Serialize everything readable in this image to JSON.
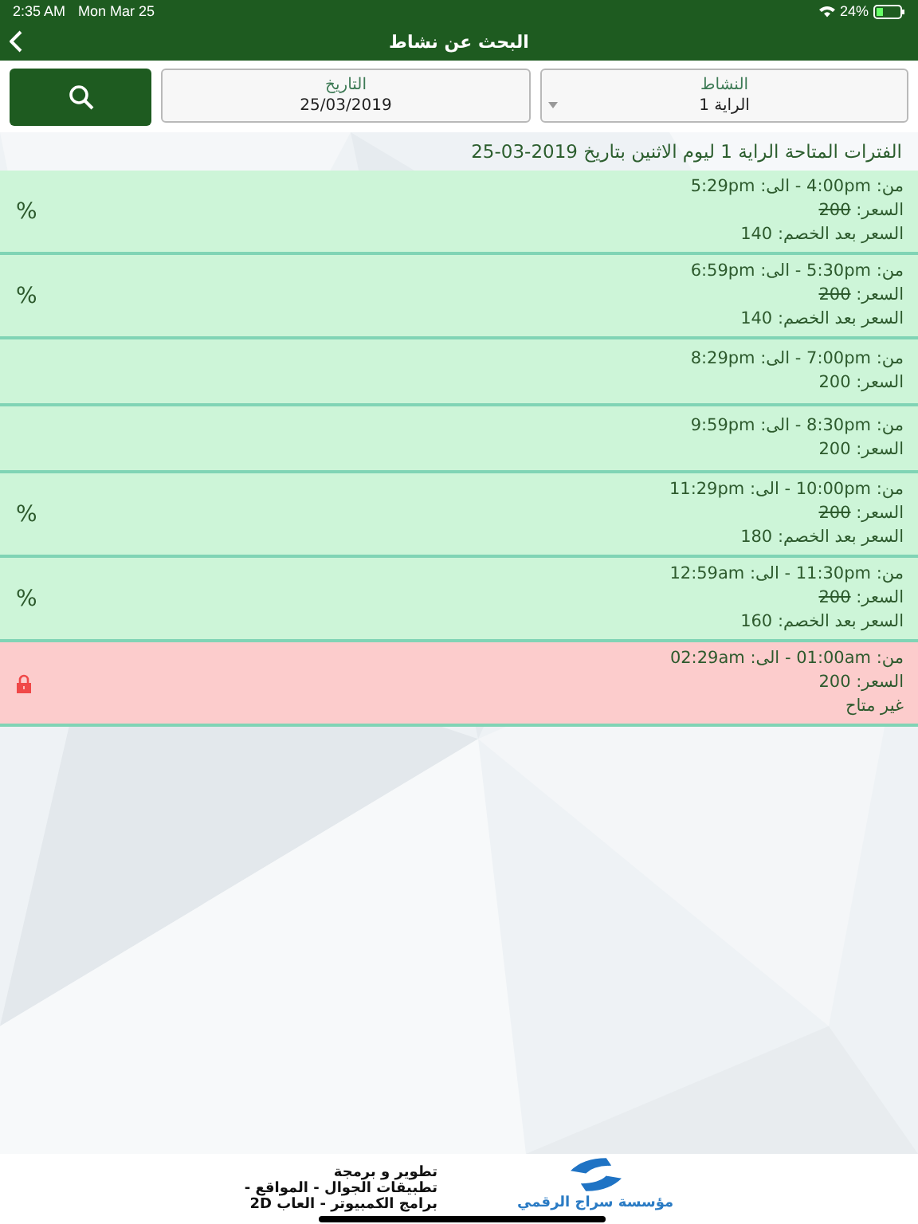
{
  "status_bar": {
    "time": "2:35 AM",
    "date": "Mon Mar 25",
    "battery": "24%"
  },
  "nav": {
    "title": "البحث عن نشاط"
  },
  "search": {
    "activity": {
      "label": "النشاط",
      "value": "الراية 1"
    },
    "date": {
      "label": "التاريخ",
      "value": "25/03/2019"
    }
  },
  "heading": "الفترات المتاحة الراية 1 ليوم الاثنين بتاريخ 2019-03-25",
  "slots": [
    {
      "kind": "discount",
      "time": "من: 4:00pm  -  الى: 5:29pm",
      "price_label": "السعر:",
      "price": "200",
      "price_struck": true,
      "note": "السعر بعد الخصم: 140",
      "badge": "%"
    },
    {
      "kind": "discount",
      "time": "من: 5:30pm  -  الى: 6:59pm",
      "price_label": "السعر:",
      "price": "200",
      "price_struck": true,
      "note": "السعر بعد الخصم: 140",
      "badge": "%"
    },
    {
      "kind": "regular",
      "time": "من: 7:00pm  -  الى: 8:29pm",
      "price_label": "السعر:",
      "price": "200",
      "price_struck": false
    },
    {
      "kind": "regular",
      "time": "من: 8:30pm  -  الى: 9:59pm",
      "price_label": "السعر:",
      "price": "200",
      "price_struck": false
    },
    {
      "kind": "discount",
      "time": "من: 10:00pm  -  الى: 11:29pm",
      "price_label": "السعر:",
      "price": "200",
      "price_struck": true,
      "note": "السعر بعد الخصم: 180",
      "badge": "%"
    },
    {
      "kind": "discount",
      "time": "من: 11:30pm  -  الى: 12:59am",
      "price_label": "السعر:",
      "price": "200",
      "price_struck": true,
      "note": "السعر بعد الخصم: 160",
      "badge": "%"
    },
    {
      "kind": "unavailable",
      "time": "من: 01:00am  -  الى: 02:29am",
      "price_label": "السعر:",
      "price": "200",
      "price_struck": false,
      "note": "غير متاح"
    }
  ],
  "footer": {
    "company": "مؤسسة سراج الرقمي",
    "lines": [
      "تطوير و برمجة",
      "تطبيقات الجوال - المواقع -",
      "برامج الكمبيوتر - العاب 2D"
    ]
  }
}
